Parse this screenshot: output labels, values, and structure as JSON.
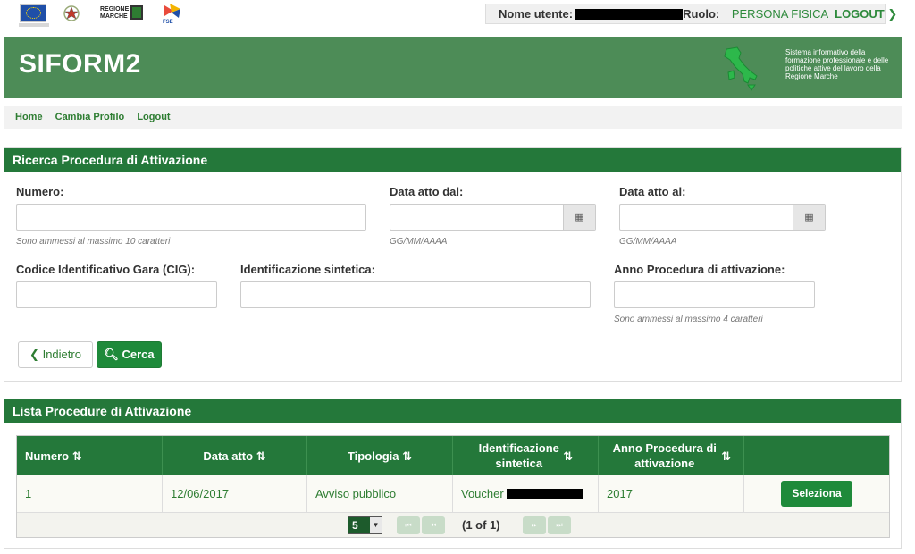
{
  "user": {
    "name_label": "Nome utente:",
    "role_label": "Ruolo:",
    "role_value": "PERSONA FISICA",
    "logout_label": "LOGOUT",
    "logout_icon": "chevron-right-icon"
  },
  "logos": {
    "regione": "REGIONE MARCHE",
    "fse": "FSE"
  },
  "header": {
    "title": "SIFORM2",
    "description": "Sistema informativo della formazione professionale e delle politiche attive del lavoro della Regione Marche"
  },
  "nav": {
    "items": [
      {
        "label": "Home"
      },
      {
        "label": "Cambia Profilo"
      },
      {
        "label": "Logout"
      }
    ]
  },
  "search_panel": {
    "title": "Ricerca Procedura di Attivazione",
    "numero": {
      "label": "Numero:",
      "value": "",
      "help": "Sono ammessi al massimo 10 caratteri"
    },
    "data_dal": {
      "label": "Data atto dal:",
      "value": "",
      "help": "GG/MM/AAAA"
    },
    "data_al": {
      "label": "Data atto al:",
      "value": "",
      "help": "GG/MM/AAAA"
    },
    "cig": {
      "label": "Codice Identificativo Gara (CIG):",
      "value": ""
    },
    "identificazione": {
      "label": "Identificazione sintetica:",
      "value": ""
    },
    "anno": {
      "label": "Anno Procedura di attivazione:",
      "value": "",
      "help": "Sono ammessi al massimo 4 caratteri"
    },
    "back_label": "Indietro",
    "search_label": "Cerca"
  },
  "list_panel": {
    "title": "Lista Procedure di Attivazione",
    "columns": [
      "Numero",
      "Data atto",
      "Tipologia",
      "Identificazione sintetica",
      "Anno Procedura di attivazione"
    ],
    "sort_icon": "sort-icon",
    "rows": [
      {
        "numero": "1",
        "data_atto": "12/06/2017",
        "tipologia": "Avviso pubblico",
        "identificazione": "Voucher",
        "anno": "2017",
        "action": "Seleziona"
      }
    ],
    "pager": {
      "rows_per_page": "5",
      "info": "(1 of 1)"
    }
  }
}
